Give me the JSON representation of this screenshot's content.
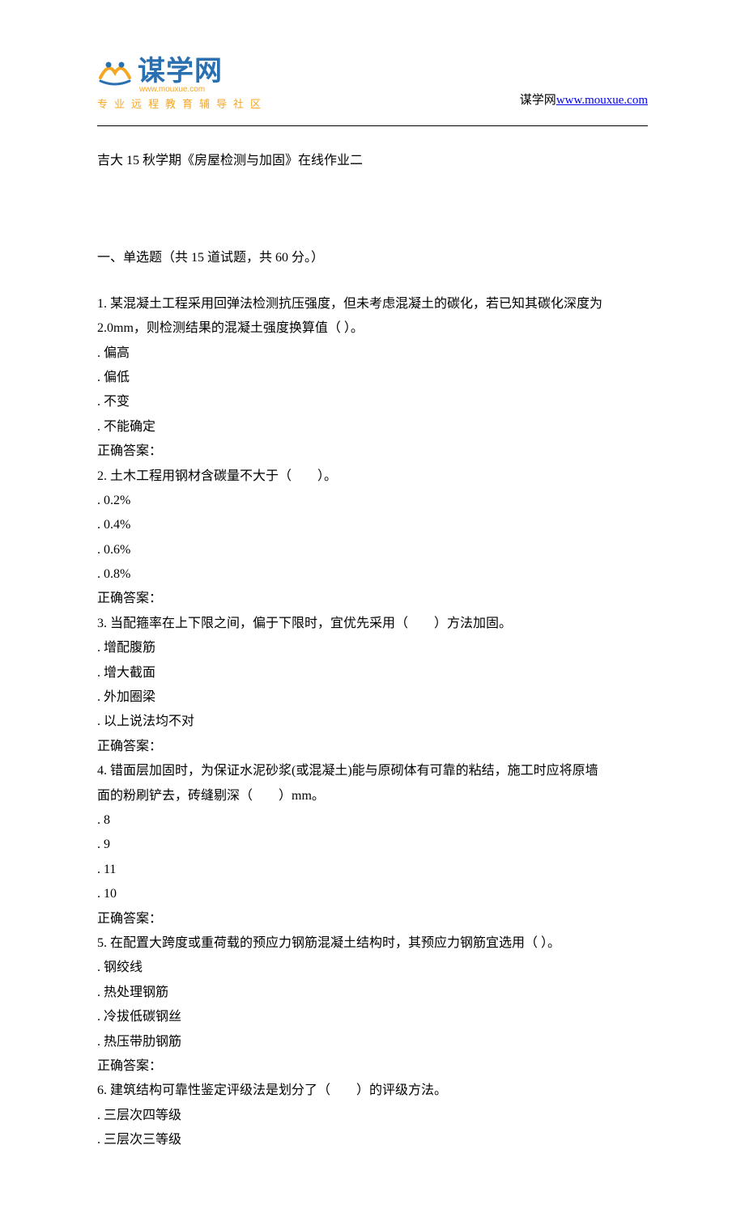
{
  "header": {
    "logo_main": "谋学网",
    "logo_url": "www.mouxue.com",
    "logo_tagline": "专业远程教育辅导社区",
    "site_label": "谋学网",
    "site_url_text": "www.mouxue.com"
  },
  "doc_title": "吉大 15 秋学期《房屋检测与加固》在线作业二",
  "section_heading": "一、单选题（共 15 道试题，共 60 分。）",
  "answer_label": "正确答案：",
  "questions": [
    {
      "num": "1.",
      "text_lines": [
        "某混凝土工程采用回弹法检测抗压强度，但未考虑混凝土的碳化，若已知其碳化深度为",
        "2.0mm，则检测结果的混凝土强度换算值（ ）。"
      ],
      "options": [
        "偏高",
        "偏低",
        "不变",
        "不能确定"
      ]
    },
    {
      "num": "2.",
      "text_lines": [
        "土木工程用钢材含碳量不大于（　　）。"
      ],
      "options": [
        "0.2%",
        "0.4%",
        "0.6%",
        "0.8%"
      ]
    },
    {
      "num": "3.",
      "text_lines": [
        "当配箍率在上下限之间，偏于下限时，宜优先采用（　　）方法加固。"
      ],
      "options": [
        "增配腹筋",
        "增大截面",
        "外加圈梁",
        "以上说法均不对"
      ]
    },
    {
      "num": "4.",
      "text_lines": [
        "错面层加固时，为保证水泥砂浆(或混凝土)能与原砌体有可靠的粘结，施工时应将原墙",
        "面的粉刷铲去，砖缝剔深（　　）mm。"
      ],
      "options": [
        "8",
        "9",
        "11",
        "10"
      ]
    },
    {
      "num": "5.",
      "text_lines": [
        "在配置大跨度或重荷载的预应力钢筋混凝土结构时，其预应力钢筋宜选用（ ）。"
      ],
      "options": [
        "钢绞线",
        "热处理钢筋",
        "冷拔低碳钢丝",
        "热压带肋钢筋"
      ]
    },
    {
      "num": "6.",
      "text_lines": [
        "建筑结构可靠性鉴定评级法是划分了（　　）的评级方法。"
      ],
      "options": [
        "三层次四等级",
        "三层次三等级"
      ],
      "show_answer": false
    }
  ]
}
